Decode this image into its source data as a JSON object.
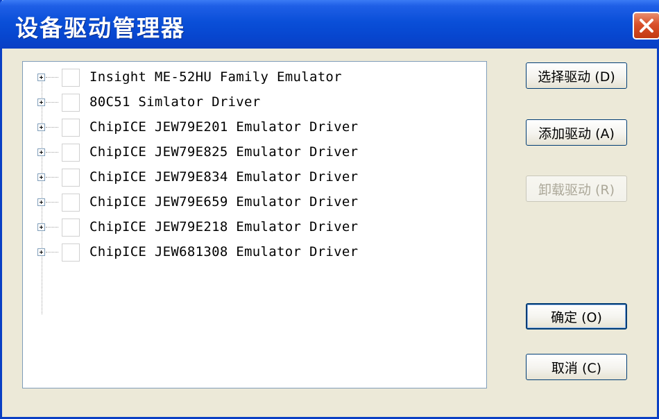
{
  "window": {
    "title": "设备驱动管理器",
    "close_icon": "close-icon"
  },
  "tree": {
    "items": [
      {
        "label": "Insight ME-52HU Family Emulator",
        "checked": false,
        "expanded": false
      },
      {
        "label": "80C51 Simlator Driver",
        "checked": false,
        "expanded": false
      },
      {
        "label": "ChipICE JEW79E201 Emulator Driver",
        "checked": false,
        "expanded": false
      },
      {
        "label": "ChipICE JEW79E825 Emulator Driver",
        "checked": false,
        "expanded": false
      },
      {
        "label": "ChipICE JEW79E834 Emulator Driver",
        "checked": false,
        "expanded": false
      },
      {
        "label": "ChipICE JEW79E659 Emulator Driver",
        "checked": false,
        "expanded": false
      },
      {
        "label": "ChipICE JEW79E218 Emulator Driver",
        "checked": false,
        "expanded": false
      },
      {
        "label": "ChipICE JEW681308 Emulator Driver",
        "checked": false,
        "expanded": false
      }
    ]
  },
  "buttons": {
    "select_driver": "选择驱动 (D)",
    "add_driver": "添加驱动 (A)",
    "remove_driver": "卸载驱动 (R)",
    "ok": "确定 (O)",
    "cancel": "取消 (C)"
  }
}
